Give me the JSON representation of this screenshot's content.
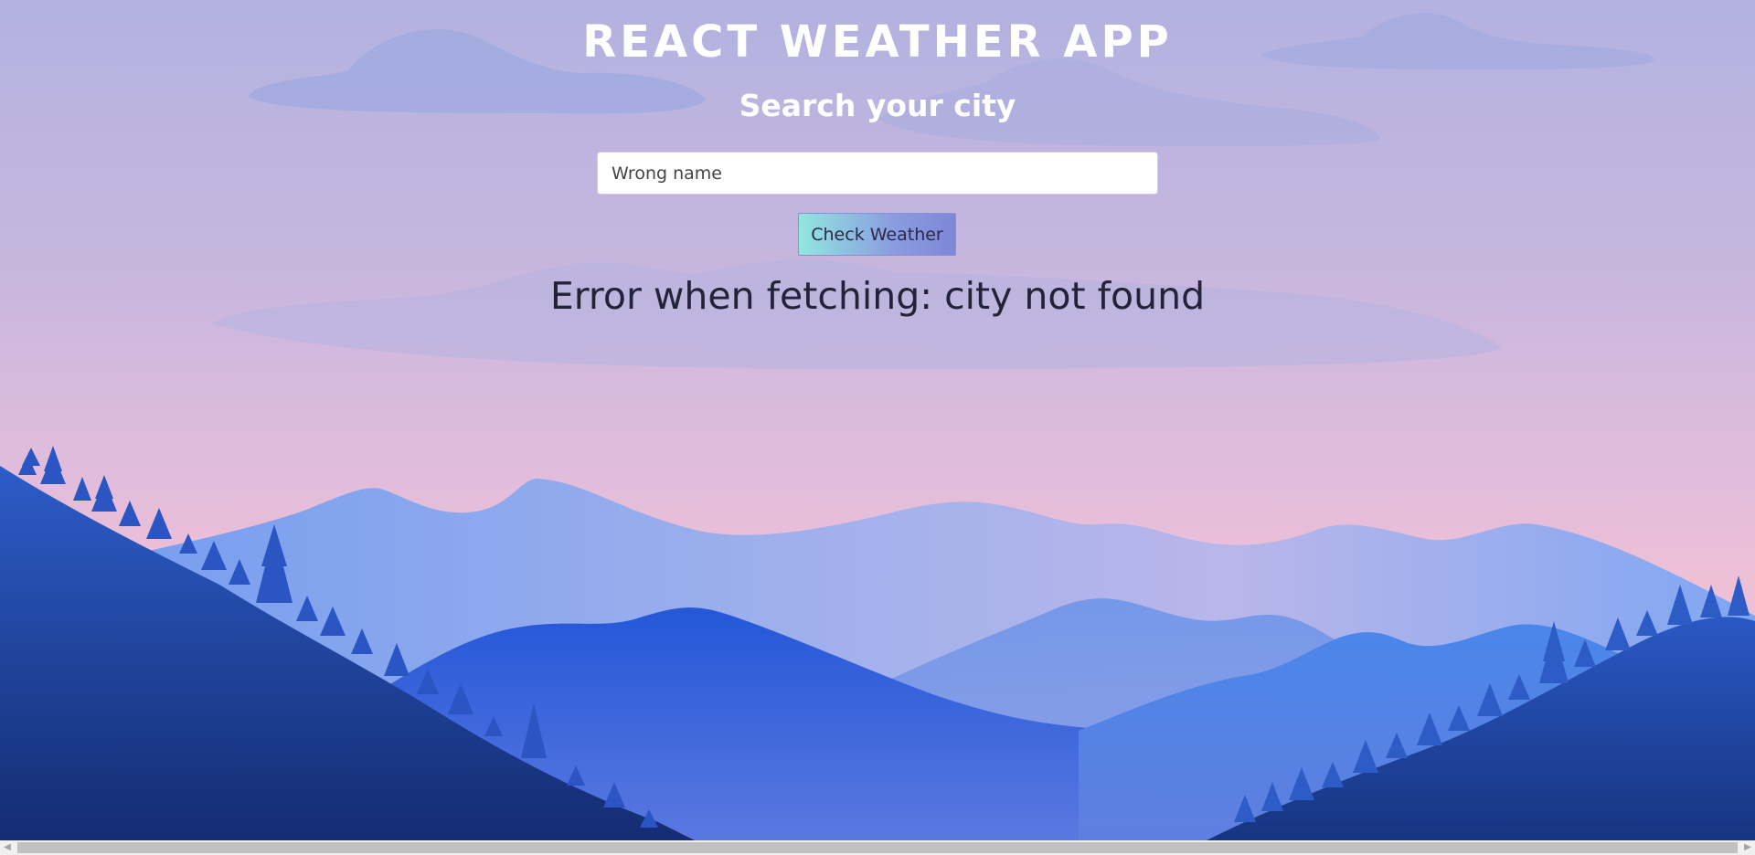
{
  "header": {
    "title": "REACT WEATHER APP",
    "subtitle": "Search your city"
  },
  "search": {
    "value": "Wrong name",
    "placeholder": ""
  },
  "actions": {
    "check_label": "Check Weather"
  },
  "status": {
    "error_message": "Error when fetching: city not found"
  },
  "scrollbar": {
    "left_arrow": "◀",
    "right_arrow": "▶"
  },
  "colors": {
    "sky_top": "#b3b2e0",
    "sky_horizon": "#eec0d6",
    "mountain_far": "#8aa4ec",
    "mountain_mid": "#2f5fd8",
    "forest": "#1d3a8a",
    "button_gradient_start": "#92e6e0",
    "button_gradient_end": "#7f86d8",
    "title_text": "#ffffff",
    "error_text": "#222238"
  }
}
